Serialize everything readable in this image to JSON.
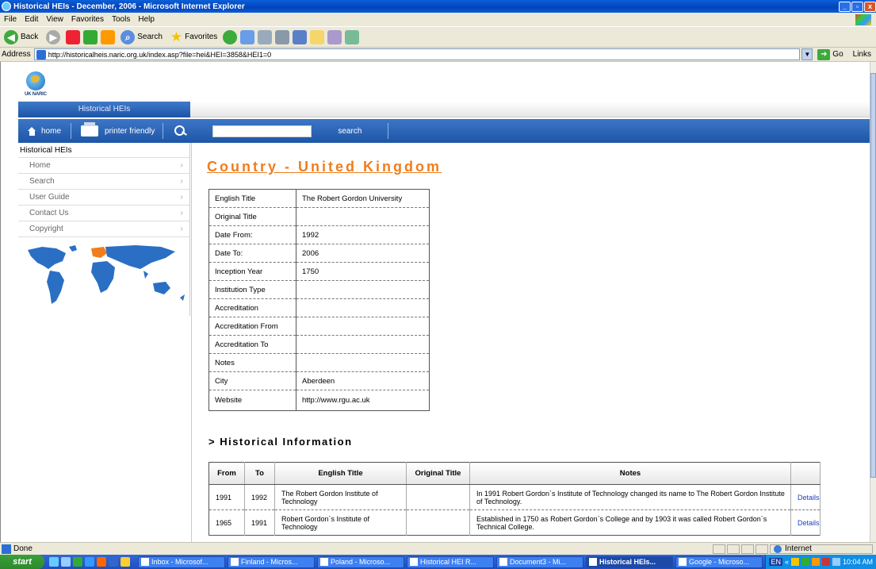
{
  "window": {
    "title": "Historical HEIs - December, 2006 - Microsoft Internet Explorer"
  },
  "menu": [
    "File",
    "Edit",
    "View",
    "Favorites",
    "Tools",
    "Help"
  ],
  "toolbar": {
    "back": "Back",
    "search": "Search",
    "favorites": "Favorites"
  },
  "address": {
    "label": "Address",
    "url": "http://historicalheis.naric.org.uk/index.asp?file=hei&HEI=3858&HEI1=0",
    "go": "Go",
    "links": "Links"
  },
  "site": {
    "logo_text": "UK NARIC",
    "tab": "Historical HEIs",
    "nav": {
      "home": "home",
      "printer": "printer friendly",
      "search": "search"
    },
    "sidebar": {
      "heading": "Historical HEIs",
      "items": [
        "Home",
        "Search",
        "User Guide",
        "Contact Us",
        "Copyright"
      ]
    },
    "country_title": "Country - United Kingdom",
    "details": [
      {
        "key": "English Title",
        "value": "The Robert Gordon University"
      },
      {
        "key": "Original Title",
        "value": ""
      },
      {
        "key": "Date From:",
        "value": "1992"
      },
      {
        "key": "Date To:",
        "value": "2006"
      },
      {
        "key": "Inception Year",
        "value": "1750"
      },
      {
        "key": "Institution Type",
        "value": ""
      },
      {
        "key": "Accreditation",
        "value": ""
      },
      {
        "key": "Accreditation From",
        "value": ""
      },
      {
        "key": "Accreditation To",
        "value": ""
      },
      {
        "key": "Notes",
        "value": ""
      },
      {
        "key": "City",
        "value": "Aberdeen"
      },
      {
        "key": "Website",
        "value": "http://www.rgu.ac.uk"
      }
    ],
    "history_heading": "> Historical Information",
    "history_headers": [
      "From",
      "To",
      "English Title",
      "Original Title",
      "Notes",
      ""
    ],
    "history_rows": [
      {
        "from": "1991",
        "to": "1992",
        "english": "The Robert Gordon Institute of Technology",
        "original": "",
        "notes": "In 1991 Robert Gordon`s Institute of Technology changed its name to The Robert Gordon Institute of Technology.",
        "link": "Details"
      },
      {
        "from": "1965",
        "to": "1991",
        "english": "Robert Gordon`s Institute of Technology",
        "original": "",
        "notes": "Established in 1750 as Robert Gordon`s College and by 1903 it was called Robert Gordon`s Technical College.",
        "link": "Details"
      }
    ]
  },
  "status": {
    "text": "Done",
    "zone": "Internet"
  },
  "taskbar": {
    "start": "start",
    "tasks": [
      "Inbox - Microsof...",
      "Finland - Micros...",
      "Poland - Microso...",
      "Historical HEI R...",
      "Document3 - Mi...",
      "Historical HEIs...",
      "Google - Microso..."
    ],
    "lang": "EN",
    "clock": "10:04 AM"
  }
}
